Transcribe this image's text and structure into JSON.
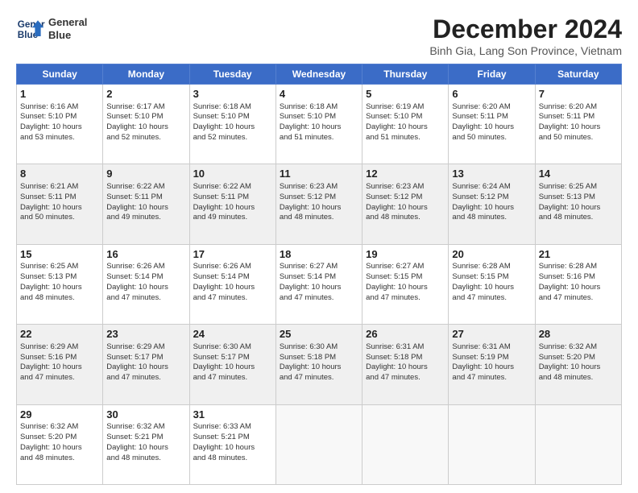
{
  "header": {
    "logo_line1": "General",
    "logo_line2": "Blue",
    "title": "December 2024",
    "subtitle": "Binh Gia, Lang Son Province, Vietnam"
  },
  "days_of_week": [
    "Sunday",
    "Monday",
    "Tuesday",
    "Wednesday",
    "Thursday",
    "Friday",
    "Saturday"
  ],
  "weeks": [
    [
      {
        "day": 1,
        "lines": [
          "Sunrise: 6:16 AM",
          "Sunset: 5:10 PM",
          "Daylight: 10 hours",
          "and 53 minutes."
        ]
      },
      {
        "day": 2,
        "lines": [
          "Sunrise: 6:17 AM",
          "Sunset: 5:10 PM",
          "Daylight: 10 hours",
          "and 52 minutes."
        ]
      },
      {
        "day": 3,
        "lines": [
          "Sunrise: 6:18 AM",
          "Sunset: 5:10 PM",
          "Daylight: 10 hours",
          "and 52 minutes."
        ]
      },
      {
        "day": 4,
        "lines": [
          "Sunrise: 6:18 AM",
          "Sunset: 5:10 PM",
          "Daylight: 10 hours",
          "and 51 minutes."
        ]
      },
      {
        "day": 5,
        "lines": [
          "Sunrise: 6:19 AM",
          "Sunset: 5:10 PM",
          "Daylight: 10 hours",
          "and 51 minutes."
        ]
      },
      {
        "day": 6,
        "lines": [
          "Sunrise: 6:20 AM",
          "Sunset: 5:11 PM",
          "Daylight: 10 hours",
          "and 50 minutes."
        ]
      },
      {
        "day": 7,
        "lines": [
          "Sunrise: 6:20 AM",
          "Sunset: 5:11 PM",
          "Daylight: 10 hours",
          "and 50 minutes."
        ]
      }
    ],
    [
      {
        "day": 8,
        "lines": [
          "Sunrise: 6:21 AM",
          "Sunset: 5:11 PM",
          "Daylight: 10 hours",
          "and 50 minutes."
        ]
      },
      {
        "day": 9,
        "lines": [
          "Sunrise: 6:22 AM",
          "Sunset: 5:11 PM",
          "Daylight: 10 hours",
          "and 49 minutes."
        ]
      },
      {
        "day": 10,
        "lines": [
          "Sunrise: 6:22 AM",
          "Sunset: 5:11 PM",
          "Daylight: 10 hours",
          "and 49 minutes."
        ]
      },
      {
        "day": 11,
        "lines": [
          "Sunrise: 6:23 AM",
          "Sunset: 5:12 PM",
          "Daylight: 10 hours",
          "and 48 minutes."
        ]
      },
      {
        "day": 12,
        "lines": [
          "Sunrise: 6:23 AM",
          "Sunset: 5:12 PM",
          "Daylight: 10 hours",
          "and 48 minutes."
        ]
      },
      {
        "day": 13,
        "lines": [
          "Sunrise: 6:24 AM",
          "Sunset: 5:12 PM",
          "Daylight: 10 hours",
          "and 48 minutes."
        ]
      },
      {
        "day": 14,
        "lines": [
          "Sunrise: 6:25 AM",
          "Sunset: 5:13 PM",
          "Daylight: 10 hours",
          "and 48 minutes."
        ]
      }
    ],
    [
      {
        "day": 15,
        "lines": [
          "Sunrise: 6:25 AM",
          "Sunset: 5:13 PM",
          "Daylight: 10 hours",
          "and 48 minutes."
        ]
      },
      {
        "day": 16,
        "lines": [
          "Sunrise: 6:26 AM",
          "Sunset: 5:14 PM",
          "Daylight: 10 hours",
          "and 47 minutes."
        ]
      },
      {
        "day": 17,
        "lines": [
          "Sunrise: 6:26 AM",
          "Sunset: 5:14 PM",
          "Daylight: 10 hours",
          "and 47 minutes."
        ]
      },
      {
        "day": 18,
        "lines": [
          "Sunrise: 6:27 AM",
          "Sunset: 5:14 PM",
          "Daylight: 10 hours",
          "and 47 minutes."
        ]
      },
      {
        "day": 19,
        "lines": [
          "Sunrise: 6:27 AM",
          "Sunset: 5:15 PM",
          "Daylight: 10 hours",
          "and 47 minutes."
        ]
      },
      {
        "day": 20,
        "lines": [
          "Sunrise: 6:28 AM",
          "Sunset: 5:15 PM",
          "Daylight: 10 hours",
          "and 47 minutes."
        ]
      },
      {
        "day": 21,
        "lines": [
          "Sunrise: 6:28 AM",
          "Sunset: 5:16 PM",
          "Daylight: 10 hours",
          "and 47 minutes."
        ]
      }
    ],
    [
      {
        "day": 22,
        "lines": [
          "Sunrise: 6:29 AM",
          "Sunset: 5:16 PM",
          "Daylight: 10 hours",
          "and 47 minutes."
        ]
      },
      {
        "day": 23,
        "lines": [
          "Sunrise: 6:29 AM",
          "Sunset: 5:17 PM",
          "Daylight: 10 hours",
          "and 47 minutes."
        ]
      },
      {
        "day": 24,
        "lines": [
          "Sunrise: 6:30 AM",
          "Sunset: 5:17 PM",
          "Daylight: 10 hours",
          "and 47 minutes."
        ]
      },
      {
        "day": 25,
        "lines": [
          "Sunrise: 6:30 AM",
          "Sunset: 5:18 PM",
          "Daylight: 10 hours",
          "and 47 minutes."
        ]
      },
      {
        "day": 26,
        "lines": [
          "Sunrise: 6:31 AM",
          "Sunset: 5:18 PM",
          "Daylight: 10 hours",
          "and 47 minutes."
        ]
      },
      {
        "day": 27,
        "lines": [
          "Sunrise: 6:31 AM",
          "Sunset: 5:19 PM",
          "Daylight: 10 hours",
          "and 47 minutes."
        ]
      },
      {
        "day": 28,
        "lines": [
          "Sunrise: 6:32 AM",
          "Sunset: 5:20 PM",
          "Daylight: 10 hours",
          "and 48 minutes."
        ]
      }
    ],
    [
      {
        "day": 29,
        "lines": [
          "Sunrise: 6:32 AM",
          "Sunset: 5:20 PM",
          "Daylight: 10 hours",
          "and 48 minutes."
        ]
      },
      {
        "day": 30,
        "lines": [
          "Sunrise: 6:32 AM",
          "Sunset: 5:21 PM",
          "Daylight: 10 hours",
          "and 48 minutes."
        ]
      },
      {
        "day": 31,
        "lines": [
          "Sunrise: 6:33 AM",
          "Sunset: 5:21 PM",
          "Daylight: 10 hours",
          "and 48 minutes."
        ]
      },
      null,
      null,
      null,
      null
    ]
  ]
}
